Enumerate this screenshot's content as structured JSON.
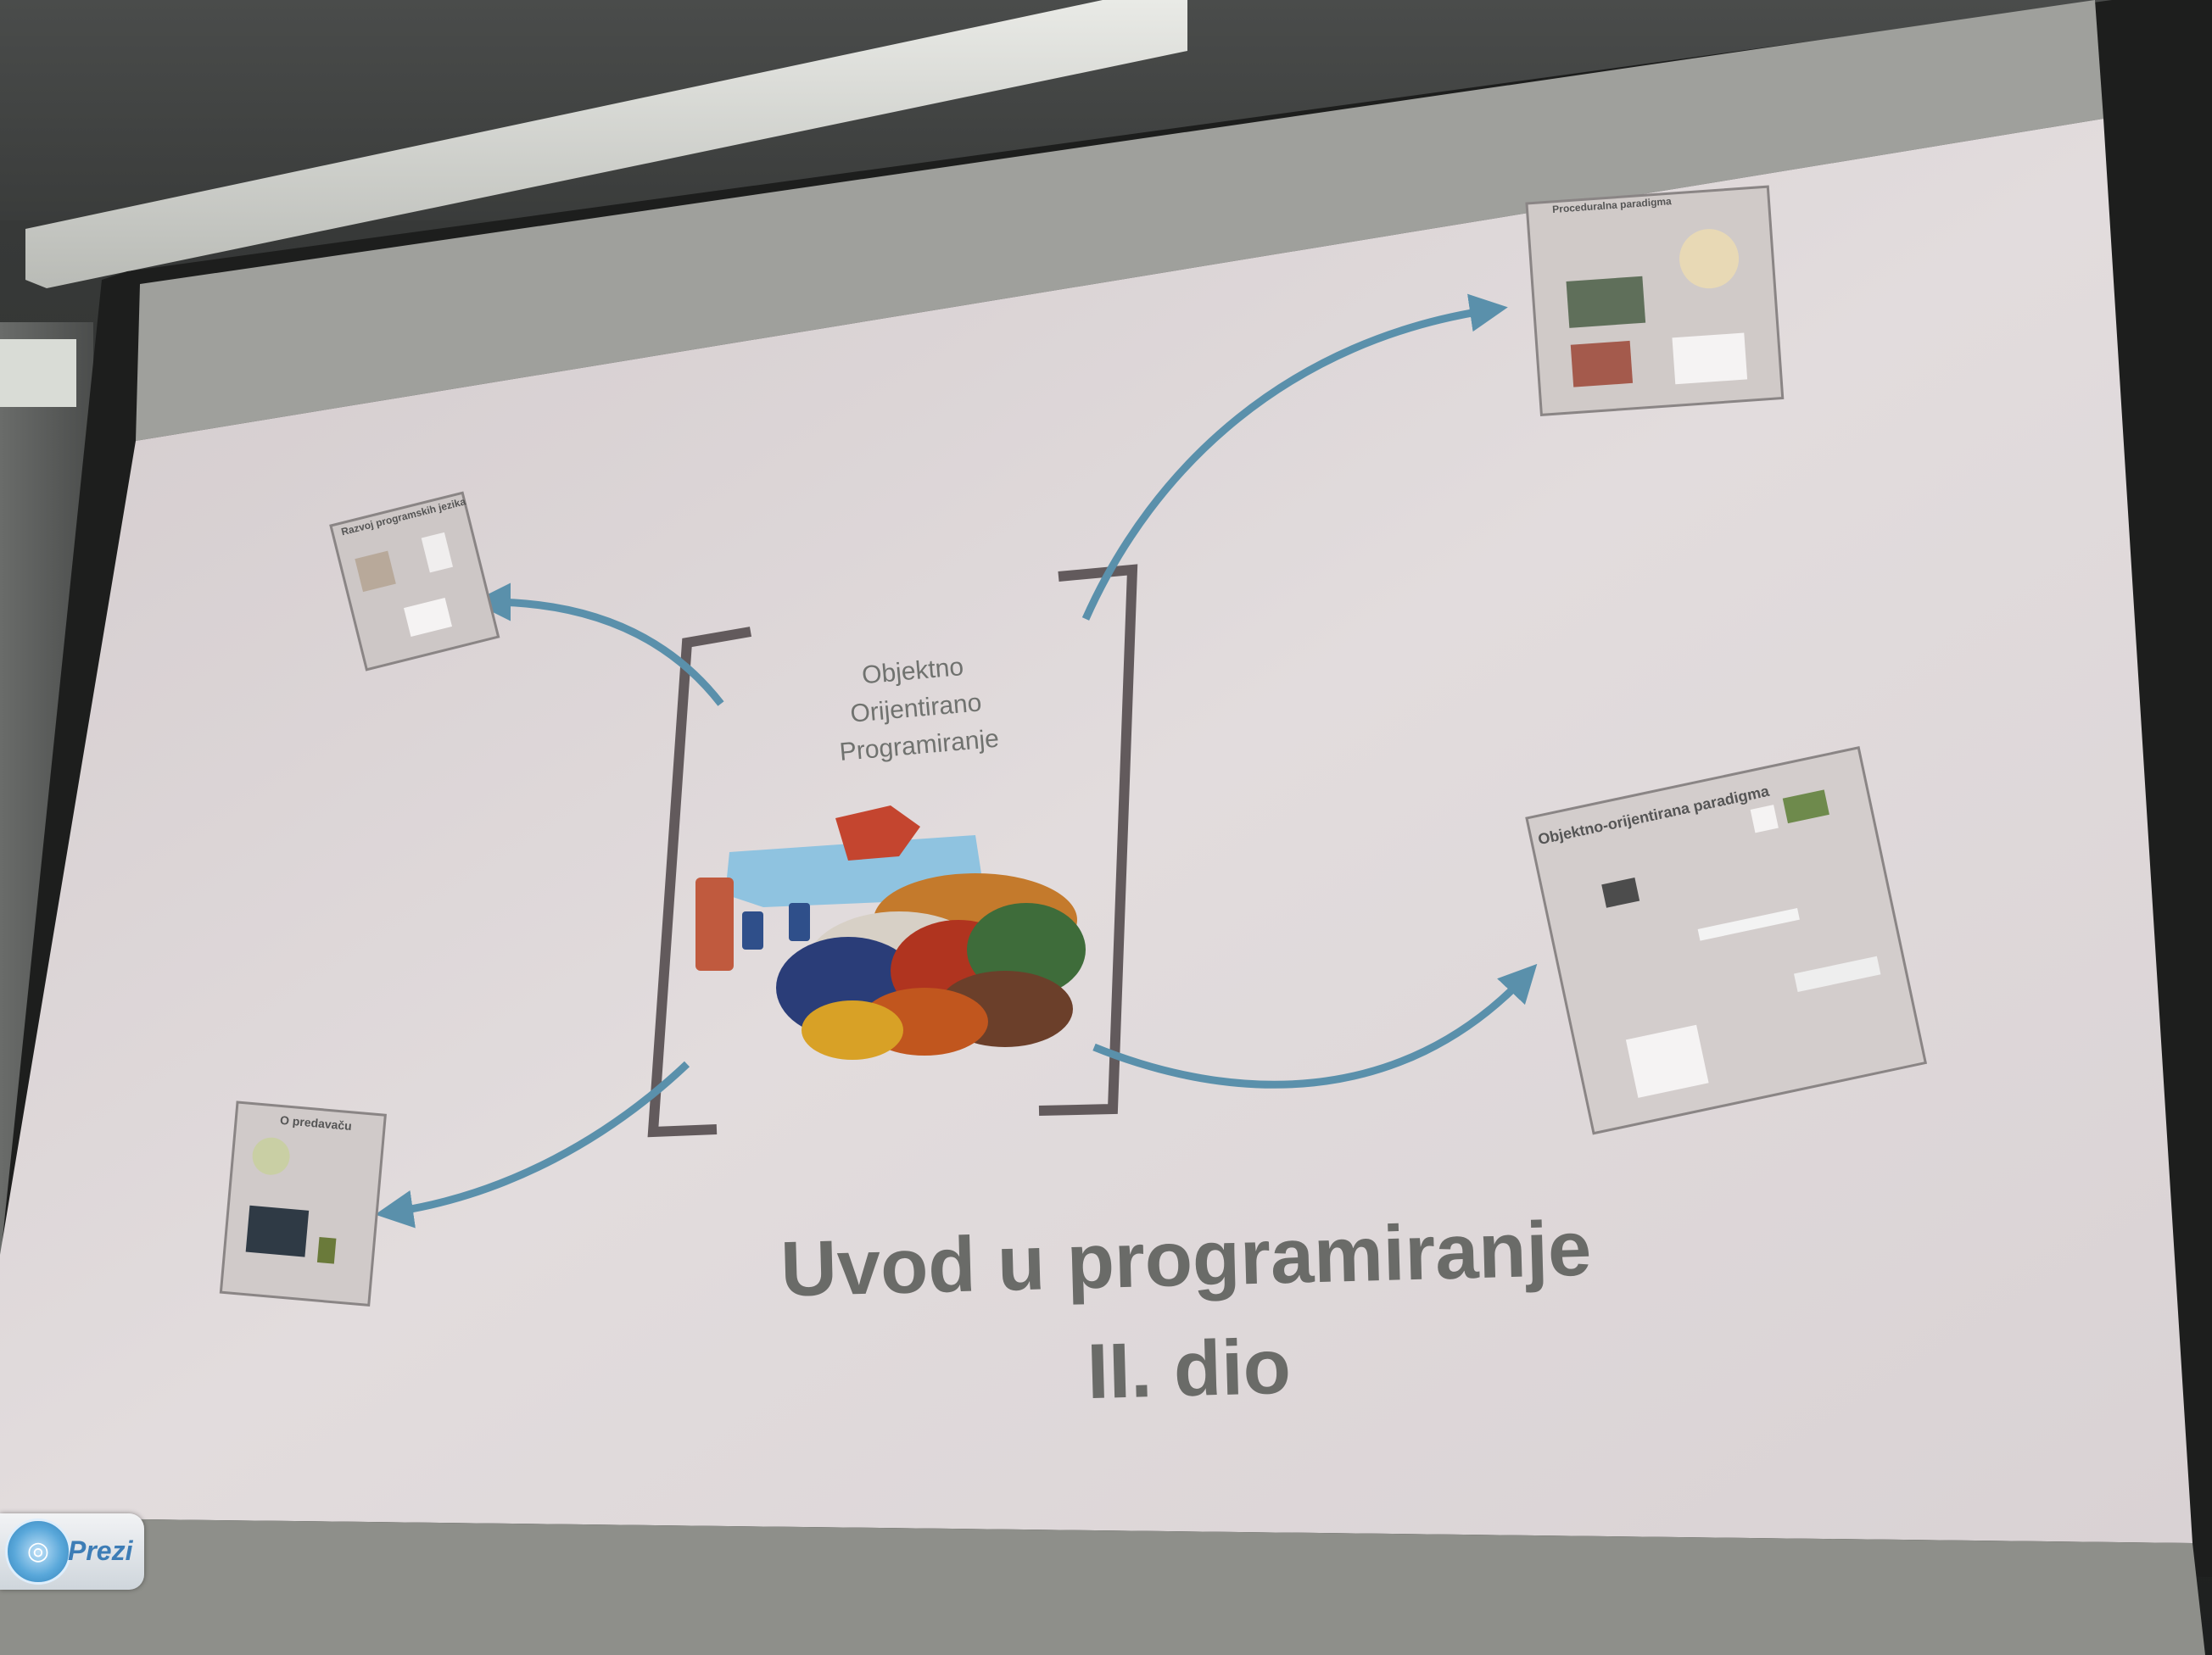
{
  "presentation": {
    "topic_title_lines": [
      "Objektno",
      "Orijentirano",
      "Programiranje"
    ],
    "main_title_lines": [
      "Uvod u programiranje",
      "II. dio"
    ]
  },
  "badge": {
    "app_name": "Prezi",
    "icon": "prezi-logo-icon"
  },
  "frames": [
    {
      "name": "frame-top-left",
      "title": "Razvoj programskih jezika"
    },
    {
      "name": "frame-top-right",
      "title": "Proceduralna paradigma"
    },
    {
      "name": "frame-right",
      "title": "Objektno-orijentirana paradigma"
    },
    {
      "name": "frame-bottom-left",
      "title": "O predavaču"
    }
  ],
  "colors": {
    "screen": "#ddd6d8",
    "arrow": "#5a90ab",
    "bracket": "#625a5c",
    "title_text": "#6a6b68",
    "prezi_blue": "#3d7db6"
  }
}
